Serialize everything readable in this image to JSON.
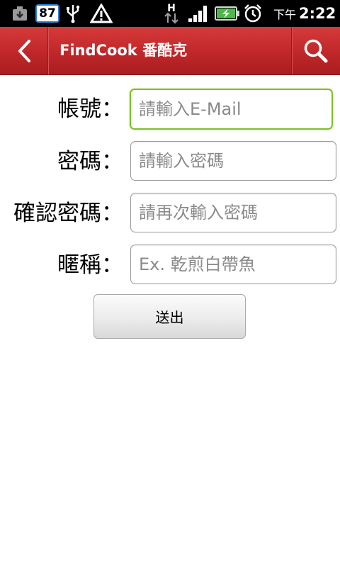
{
  "status_bar": {
    "notification_count": "87",
    "ampm": "下午",
    "time": "2:22",
    "network_type": "H",
    "icons": [
      "download-icon",
      "usb-icon",
      "warning-icon",
      "hspa-icon",
      "signal-icon",
      "battery-charging-icon",
      "alarm-icon"
    ]
  },
  "title_bar": {
    "title": "FindCook 番酷克",
    "color": "#c0272a"
  },
  "form": {
    "account": {
      "label": "帳號：",
      "placeholder": "請輸入E-Mail",
      "value": ""
    },
    "password": {
      "label": "密碼：",
      "placeholder": "請輸入密碼",
      "value": ""
    },
    "confirm_password": {
      "label": "確認密碼：",
      "placeholder": "請再次輸入密碼",
      "value": ""
    },
    "nickname": {
      "label": "暱稱：",
      "placeholder": "Ex. 乾煎白帶魚",
      "value": ""
    },
    "submit_label": "送出"
  }
}
